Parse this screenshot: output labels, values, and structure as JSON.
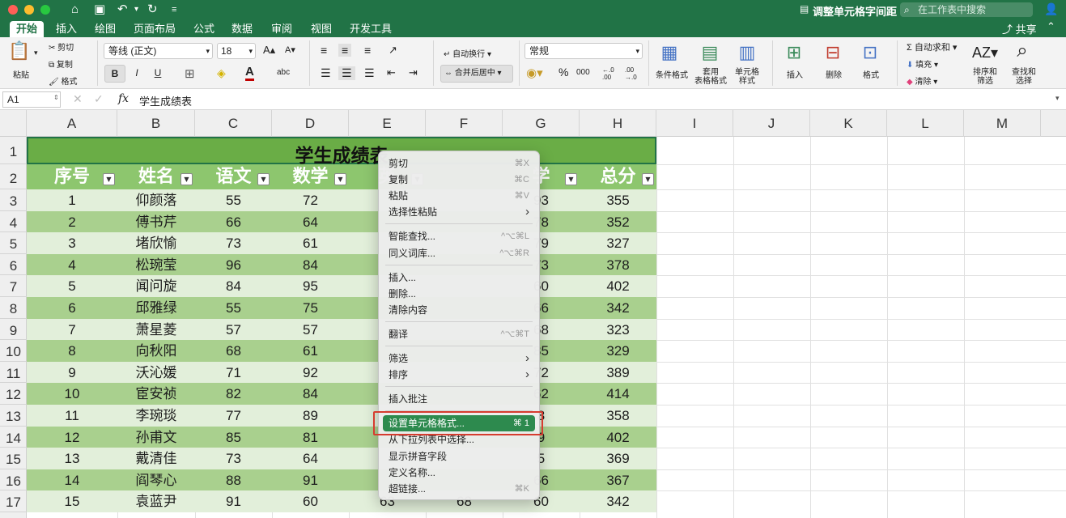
{
  "window": {
    "title": "调整单元格字间距",
    "search_placeholder": "在工作表中搜索"
  },
  "titlebar_icons": [
    "home-icon",
    "save-icon",
    "undo-icon",
    "redo-icon",
    "customize-icon"
  ],
  "tabs": [
    "开始",
    "插入",
    "绘图",
    "页面布局",
    "公式",
    "数据",
    "审阅",
    "视图",
    "开发工具"
  ],
  "share_label": "共享",
  "ribbon": {
    "paste": "粘贴",
    "cut": "剪切",
    "copy": "复制",
    "format_painter": "格式",
    "font_name": "等线 (正文)",
    "font_size": "18",
    "bold": "B",
    "italic": "I",
    "underline": "U",
    "wrap_text": "自动换行",
    "merge_center": "合并后居中",
    "number_format": "常规",
    "percent": "%",
    "thousands": "000",
    "dec_inc": "←.0 .00",
    "dec_dec": ".00 →.0",
    "conditional_format": "条件格式",
    "format_as_table": "套用\n表格格式",
    "cell_styles": "单元格\n样式",
    "insert": "插入",
    "delete": "删除",
    "format": "格式",
    "autosum": "自动求和",
    "fill": "填充",
    "clear": "清除",
    "sort_filter": "排序和\n筛选",
    "find_select": "查找和\n选择"
  },
  "formula_bar": {
    "name_box": "A1",
    "fx": "fx",
    "content": "学生成绩表"
  },
  "columns": [
    "A",
    "B",
    "C",
    "D",
    "E",
    "F",
    "G",
    "H",
    "I",
    "J",
    "K",
    "L",
    "M"
  ],
  "row_numbers": [
    "1",
    "2",
    "3",
    "4",
    "5",
    "6",
    "7",
    "8",
    "9",
    "10",
    "11",
    "12",
    "13",
    "14",
    "15",
    "16",
    "17"
  ],
  "sheet": {
    "title": "学生成绩表",
    "headers": [
      "序号",
      "姓名",
      "语文",
      "数学",
      "英",
      "",
      "学",
      "总分"
    ],
    "rows": [
      [
        "1",
        "仰颜落",
        "55",
        "72",
        "",
        "",
        "93",
        "355"
      ],
      [
        "2",
        "傅书芹",
        "66",
        "64",
        "",
        "",
        "78",
        "352"
      ],
      [
        "3",
        "堵欣愉",
        "73",
        "61",
        "",
        "",
        "79",
        "327"
      ],
      [
        "4",
        "松琬莹",
        "96",
        "84",
        "",
        "",
        "73",
        "378"
      ],
      [
        "5",
        "闻问旋",
        "84",
        "95",
        "",
        "",
        "60",
        "402"
      ],
      [
        "6",
        "邱雅绿",
        "55",
        "75",
        "",
        "",
        "66",
        "342"
      ],
      [
        "7",
        "萧星菱",
        "57",
        "57",
        "",
        "",
        "68",
        "323"
      ],
      [
        "8",
        "向秋阳",
        "68",
        "61",
        "",
        "",
        "85",
        "329"
      ],
      [
        "9",
        "沃沁媛",
        "71",
        "92",
        "",
        "",
        "72",
        "389"
      ],
      [
        "10",
        "宦安祯",
        "82",
        "84",
        "",
        "",
        "62",
        "414"
      ],
      [
        "11",
        "李琬琰",
        "77",
        "89",
        "",
        "",
        "8",
        "358"
      ],
      [
        "12",
        "孙甫文",
        "85",
        "81",
        "",
        "",
        "9",
        "402"
      ],
      [
        "13",
        "戴清佳",
        "73",
        "64",
        "",
        "",
        "5",
        "369"
      ],
      [
        "14",
        "阎琴心",
        "88",
        "91",
        "",
        "",
        "66",
        "367"
      ],
      [
        "15",
        "袁蓝尹",
        "91",
        "60",
        "63",
        "68",
        "60",
        "342"
      ]
    ]
  },
  "context_menu": [
    {
      "label": "剪切",
      "shortcut": "⌘X"
    },
    {
      "label": "复制",
      "shortcut": "⌘C"
    },
    {
      "label": "粘贴",
      "shortcut": "⌘V"
    },
    {
      "label": "选择性粘贴",
      "shortcut": "›"
    },
    {
      "label": "智能查找...",
      "shortcut": "^⌥⌘L"
    },
    {
      "label": "同义词库...",
      "shortcut": "^⌥⌘R"
    },
    {
      "label": "插入...",
      "shortcut": ""
    },
    {
      "label": "删除...",
      "shortcut": ""
    },
    {
      "label": "清除内容",
      "shortcut": ""
    },
    {
      "label": "翻译",
      "shortcut": "^⌥⌘T"
    },
    {
      "label": "筛选",
      "shortcut": "›"
    },
    {
      "label": "排序",
      "shortcut": "›"
    },
    {
      "label": "插入批注",
      "shortcut": ""
    },
    {
      "label": "设置单元格格式...",
      "shortcut": "⌘ 1"
    },
    {
      "label": "从下拉列表中选择...",
      "shortcut": ""
    },
    {
      "label": "显示拼音字段",
      "shortcut": ""
    },
    {
      "label": "定义名称...",
      "shortcut": ""
    },
    {
      "label": "超链接...",
      "shortcut": "⌘K"
    }
  ],
  "colors": {
    "accent": "#217346",
    "title_row": "#6aad46",
    "header_row": "#8dc66e",
    "band_dark": "#a9d08e",
    "band_light": "#e2efda",
    "highlight": "#d63c2f"
  }
}
